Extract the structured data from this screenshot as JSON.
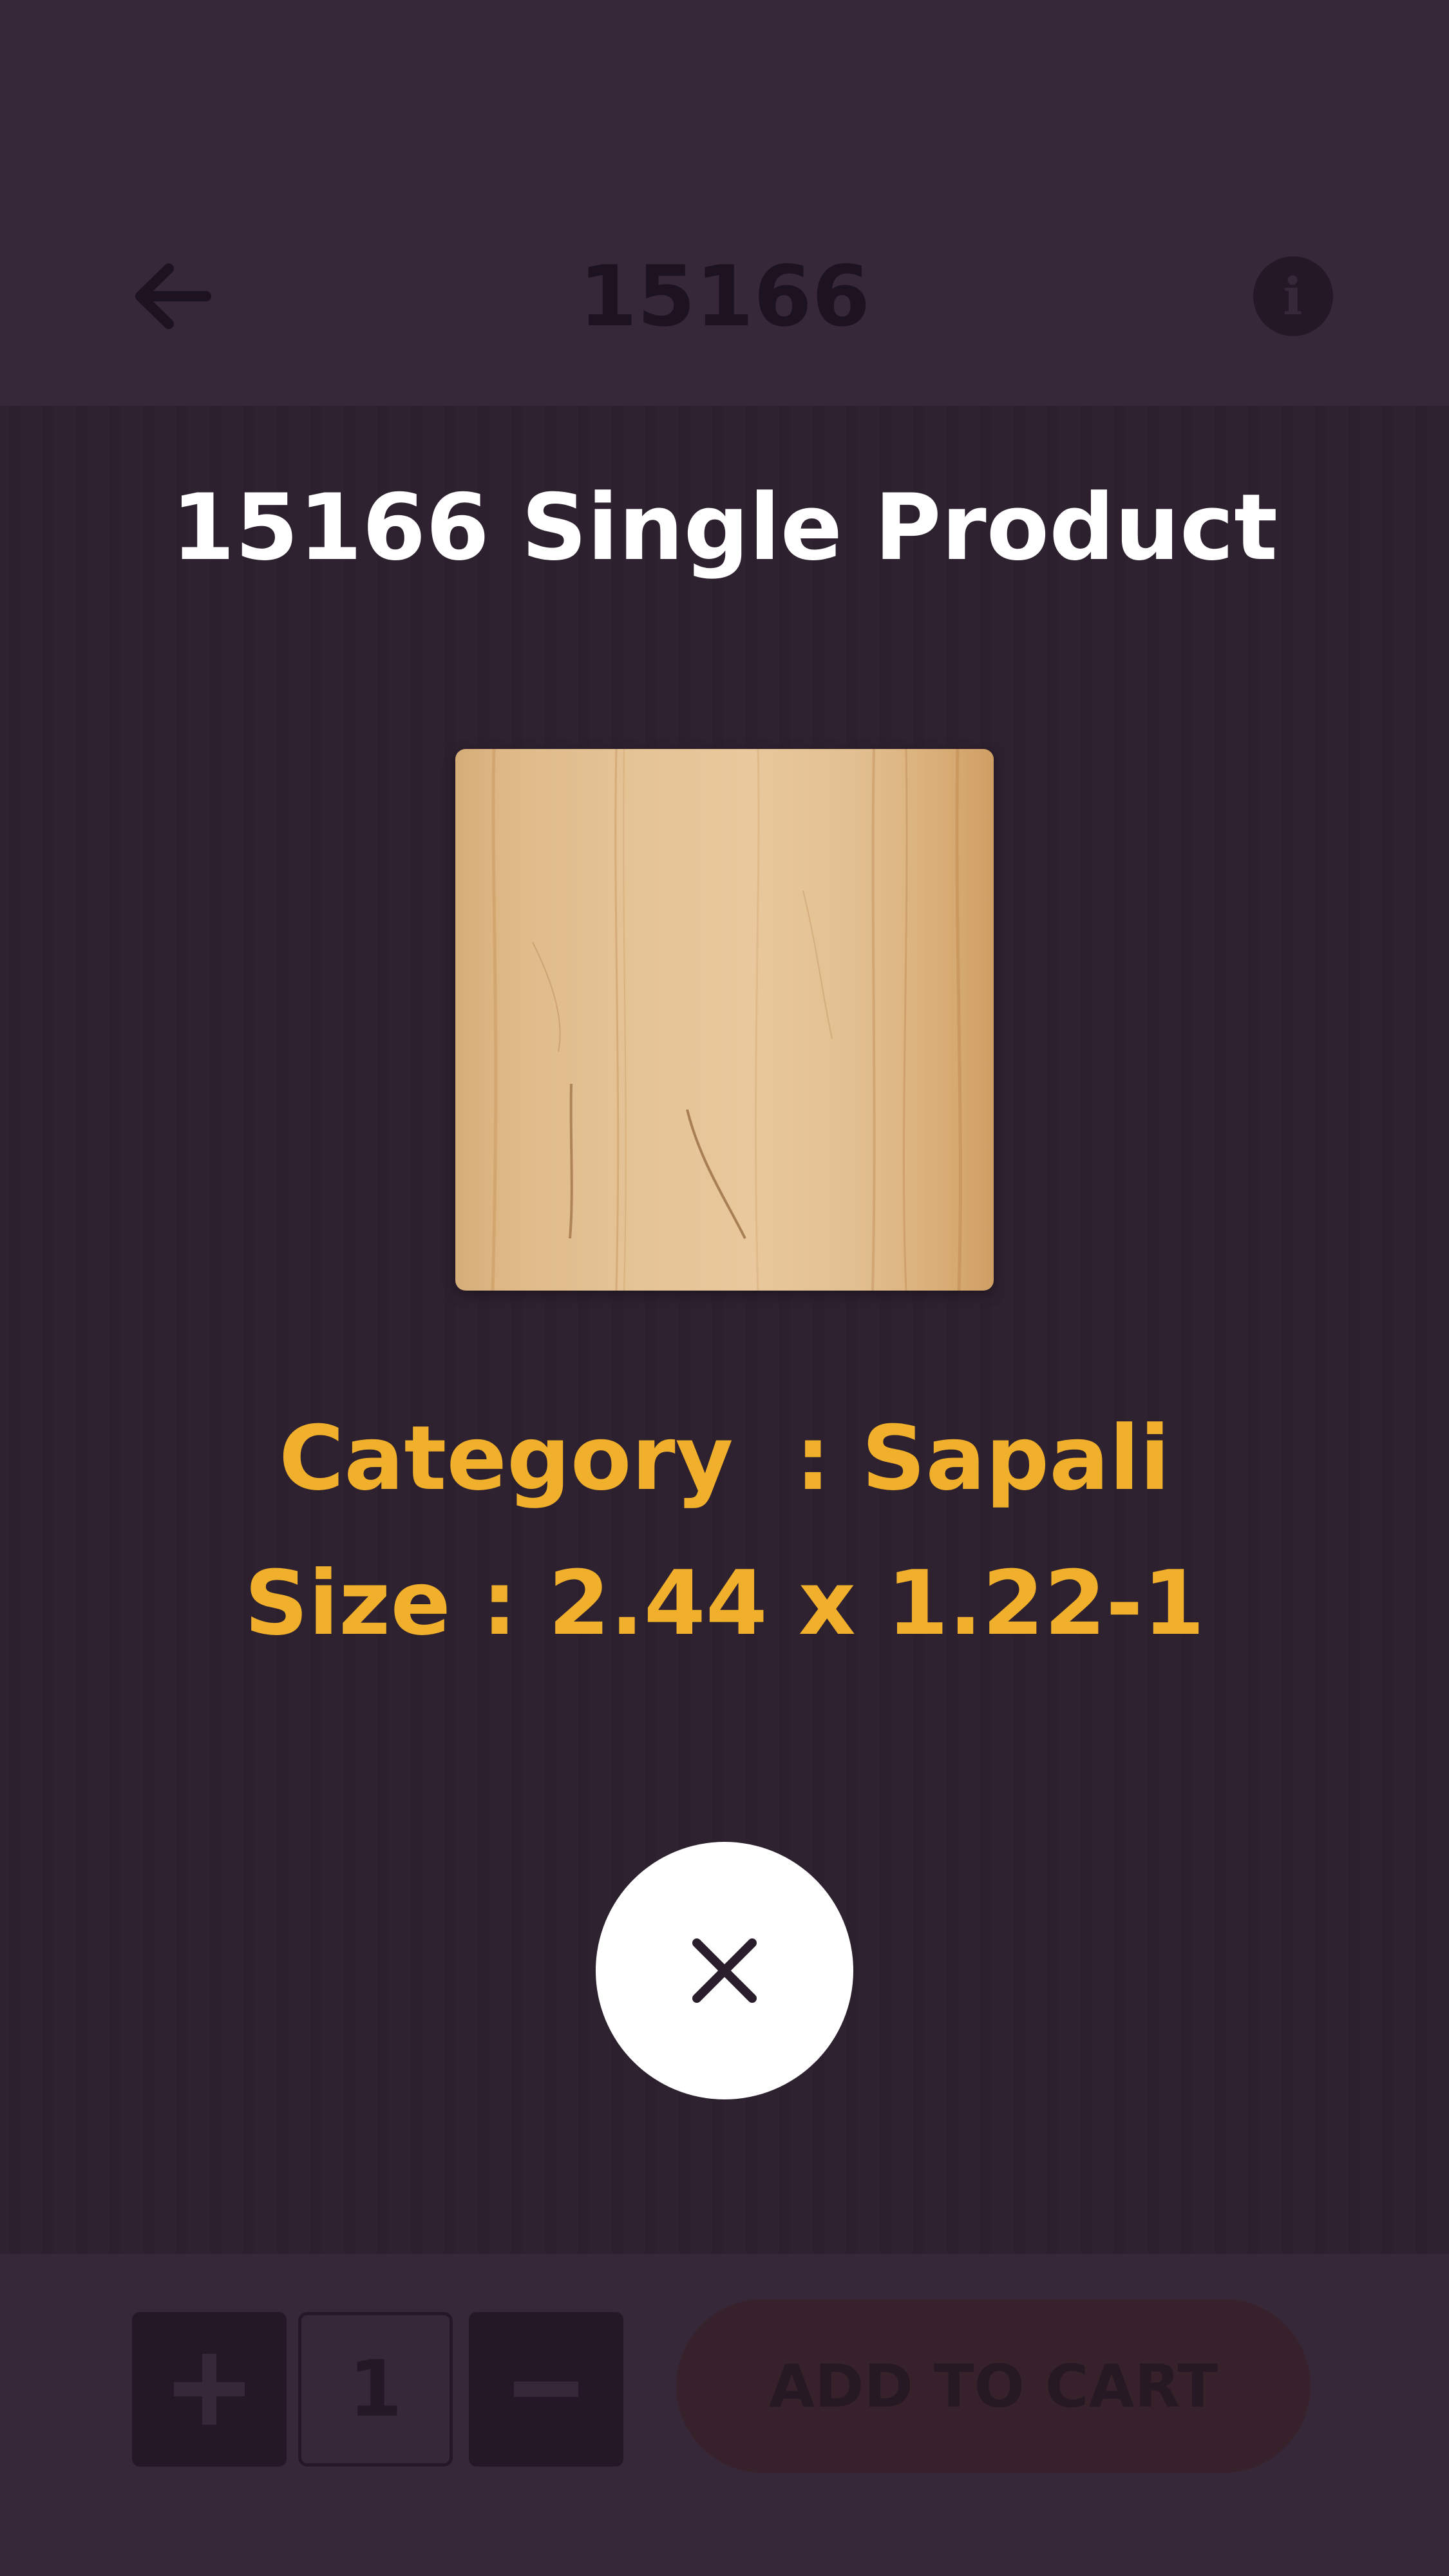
{
  "header": {
    "title": "15166",
    "back_icon": "arrow-left-icon",
    "info_icon": "info-icon",
    "info_glyph": "i"
  },
  "footer": {
    "plus_icon": "plus-icon",
    "minus_icon": "minus-icon",
    "quantity": "1",
    "add_to_cart_label": "ADD TO CART"
  },
  "modal": {
    "title": "15166 Single Product",
    "category_text": "Category  : Sapali",
    "size_text": "Size : 2.44 x 1.22-1",
    "close_icon": "close-icon"
  },
  "colors": {
    "background": "#362836",
    "header_footer": "#4a3a4c",
    "accent_text": "#f1b02b",
    "title_text": "#ffffff",
    "add_to_cart_button": "#4b2f35",
    "wood_base": "#dcb585"
  }
}
